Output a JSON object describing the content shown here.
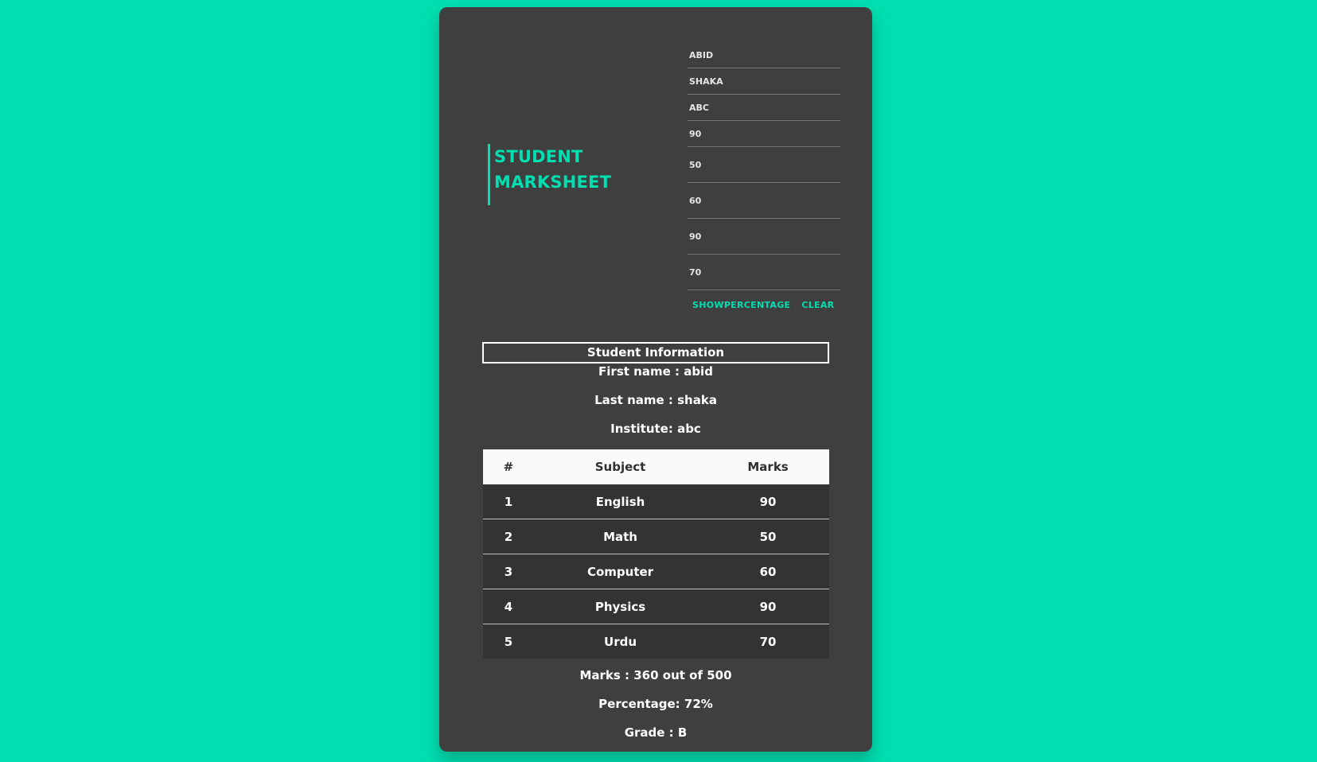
{
  "title": {
    "line1": "STUDENT",
    "line2": "MARKSHEET"
  },
  "form": {
    "first_name": "ABID",
    "last_name": "SHAKA",
    "institute": "ABC",
    "marks": [
      "90",
      "50",
      "60",
      "90",
      "70"
    ],
    "show_percentage_label": "SHOWPERCENTAGE",
    "clear_label": "CLEAR"
  },
  "info": {
    "heading": "Student Information",
    "first_name": "First name : abid",
    "last_name": "Last name : shaka",
    "institute": "Institute: abc"
  },
  "table": {
    "headers": [
      "#",
      "Subject",
      "Marks"
    ],
    "rows": [
      [
        "1",
        "English",
        "90"
      ],
      [
        "2",
        "Math",
        "50"
      ],
      [
        "3",
        "Computer",
        "60"
      ],
      [
        "4",
        "Physics",
        "90"
      ],
      [
        "5",
        "Urdu",
        "70"
      ]
    ]
  },
  "summary": {
    "marks": "Marks : 360 out of 500",
    "percentage": "Percentage: 72%",
    "grade": "Grade : B"
  },
  "colors": {
    "background": "#00dfb1",
    "card": "#3f3f3f",
    "accent": "#00dfb1"
  }
}
